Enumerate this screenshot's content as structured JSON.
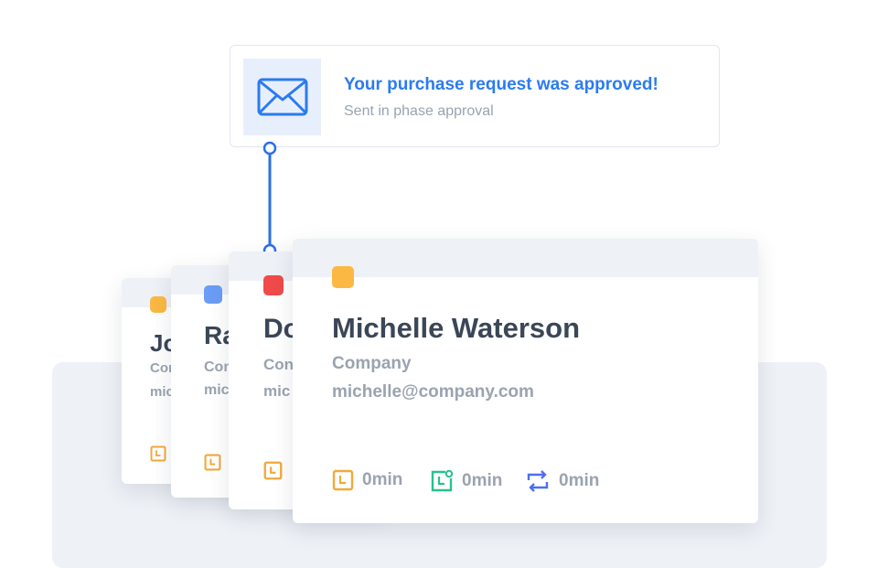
{
  "notification": {
    "title": "Your purchase request was approved!",
    "subtitle": "Sent in phase approval",
    "icon": "envelope-icon"
  },
  "colors": {
    "accent": "#2b7bf0",
    "dot_yellow": "#fbb843",
    "dot_blue": "#6b9cf6",
    "dot_red": "#f04a4a",
    "timer_orange": "#f2a93b",
    "timer_green": "#28c28c",
    "cycle_blue": "#4d6ef2"
  },
  "cards": [
    {
      "name": "Jo",
      "company": "Con",
      "email": "mic"
    },
    {
      "name": "Ra",
      "company": "Con",
      "email": "mic"
    },
    {
      "name": "Do",
      "company": "Con",
      "email": "mic"
    },
    {
      "name": "Michelle Waterson",
      "company": "Company",
      "email": "michelle@company.com",
      "stats": [
        {
          "icon": "clock-square-icon",
          "value": "0min"
        },
        {
          "icon": "clock-check-icon",
          "value": "0min"
        },
        {
          "icon": "cycle-icon",
          "value": "0min"
        }
      ]
    }
  ]
}
